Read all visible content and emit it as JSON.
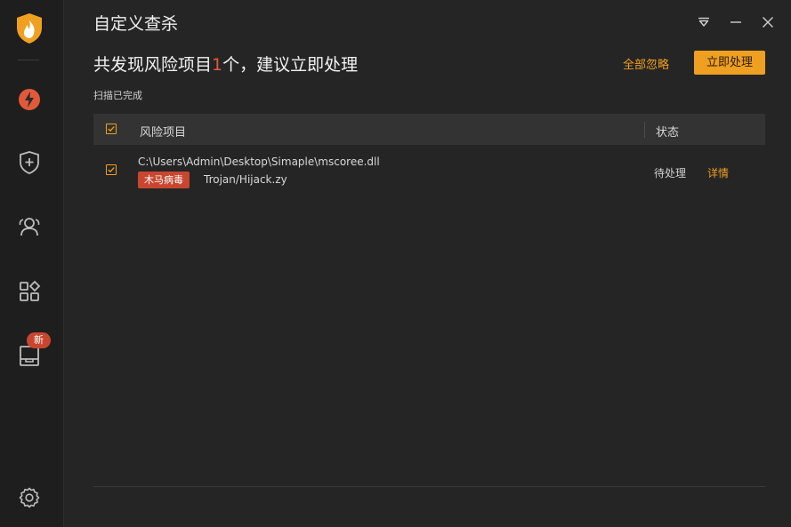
{
  "window": {
    "title": "自定义查杀",
    "controls": [
      "menu-icon",
      "minimize-icon",
      "close-icon"
    ]
  },
  "sidebar": {
    "items": [
      {
        "name": "logo",
        "icon": "flame-shield-logo"
      },
      {
        "name": "scan",
        "icon": "lightning-icon",
        "active": true
      },
      {
        "name": "protection",
        "icon": "shield-plus-icon"
      },
      {
        "name": "users",
        "icon": "users-icon"
      },
      {
        "name": "apps",
        "icon": "apps-grid-icon"
      },
      {
        "name": "toolbox",
        "icon": "box-icon",
        "badge": "新"
      },
      {
        "name": "settings",
        "icon": "gear-icon"
      }
    ]
  },
  "summary": {
    "prefix": "共发现风险项目",
    "count": "1",
    "suffix": "个，建议立即处理",
    "scan_status": "扫描已完成"
  },
  "actions": {
    "ignore_all": "全部忽略",
    "handle_now": "立即处理"
  },
  "table": {
    "headers": {
      "item": "风险项目",
      "status": "状态"
    },
    "rows": [
      {
        "checked": true,
        "path": "C:\\Users\\Admin\\Desktop\\Simaple\\mscoree.dll",
        "tag": "木马病毒",
        "threat": "Trojan/Hijack.zy",
        "status": "待处理",
        "detail": "详情"
      }
    ]
  },
  "colors": {
    "accent": "#f0a020",
    "danger": "#c8462f",
    "count": "#e05a3a",
    "background": "#252525",
    "sidebar": "#1e1e1e"
  }
}
